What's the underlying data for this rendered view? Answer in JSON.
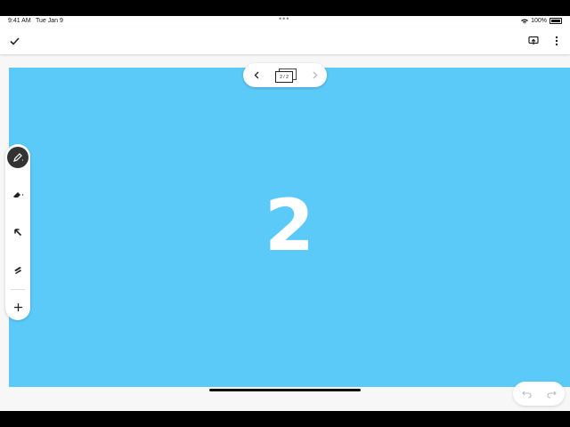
{
  "status_bar": {
    "time": "9:41 AM",
    "date": "Tue Jan 9",
    "multitask_dots": "•••",
    "battery_percent": "100%"
  },
  "top_bar": {
    "done_icon": "checkmark-icon",
    "present_icon": "present-icon",
    "more_icon": "more-vertical-icon"
  },
  "page_nav": {
    "page_indicator": "2 / 2",
    "prev_icon": "chevron-left-icon",
    "next_icon": "chevron-right-icon"
  },
  "slide": {
    "number": "2",
    "background_color": "#5bcaf8"
  },
  "toolbar": {
    "tools": [
      "pen-icon",
      "eraser-icon",
      "arrow-icon",
      "laser-pointer-icon",
      "add-icon"
    ],
    "active_tool": "pen-icon"
  },
  "undo_redo": {
    "undo_icon": "undo-icon",
    "redo_icon": "redo-icon"
  }
}
